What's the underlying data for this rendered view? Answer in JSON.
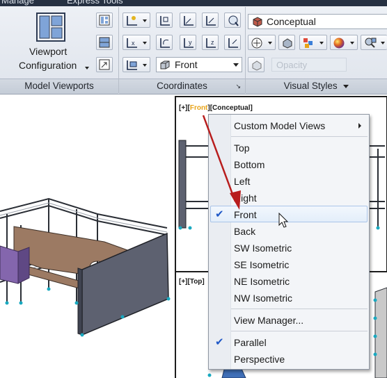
{
  "ribbon": {
    "tabs": [
      "Manage",
      "Express Tools"
    ],
    "model_viewports": {
      "button_label_line1": "Viewport",
      "button_label_line2": "Configuration",
      "panel_title": "Model Viewports"
    },
    "coordinates": {
      "view_combo_value": "Front",
      "panel_title": "Coordinates"
    },
    "visual_styles": {
      "style_combo_value": "Conceptual",
      "opacity_placeholder": "Opacity",
      "panel_title": "Visual Styles"
    }
  },
  "viewports": {
    "top_right_label_prefix": "[+][",
    "top_right_label_view": "Front",
    "top_right_label_suffix": "][Conceptual]",
    "bottom_right_label": "[+][Top]"
  },
  "context_menu": {
    "items": [
      {
        "label": "Custom Model Views",
        "submenu": true
      },
      {
        "label": "Top"
      },
      {
        "label": "Bottom"
      },
      {
        "label": "Left"
      },
      {
        "label": "Right"
      },
      {
        "label": "Front",
        "checked": true,
        "hovered": true
      },
      {
        "label": "Back"
      },
      {
        "label": "SW Isometric"
      },
      {
        "label": "SE Isometric"
      },
      {
        "label": "NE Isometric"
      },
      {
        "label": "NW Isometric"
      },
      {
        "label": "View Manager..."
      },
      {
        "label": "Parallel",
        "checked": true
      },
      {
        "label": "Perspective"
      }
    ]
  },
  "colors": {
    "accent_check": "#1f58c7",
    "annotation_arrow": "#b81d1d",
    "view_highlight": "#e8a317"
  }
}
